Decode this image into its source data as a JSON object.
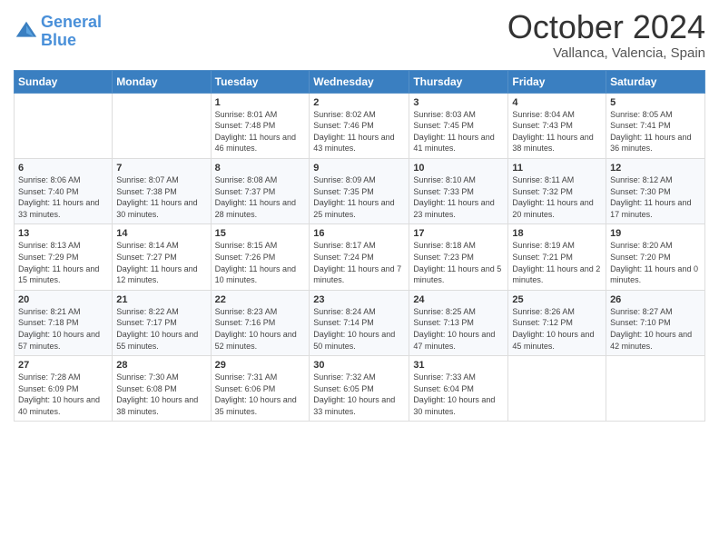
{
  "header": {
    "logo_line1": "General",
    "logo_line2": "Blue",
    "month": "October 2024",
    "location": "Vallanca, Valencia, Spain"
  },
  "days_of_week": [
    "Sunday",
    "Monday",
    "Tuesday",
    "Wednesday",
    "Thursday",
    "Friday",
    "Saturday"
  ],
  "weeks": [
    [
      {
        "day": "",
        "info": ""
      },
      {
        "day": "",
        "info": ""
      },
      {
        "day": "1",
        "info": "Sunrise: 8:01 AM\nSunset: 7:48 PM\nDaylight: 11 hours and 46 minutes."
      },
      {
        "day": "2",
        "info": "Sunrise: 8:02 AM\nSunset: 7:46 PM\nDaylight: 11 hours and 43 minutes."
      },
      {
        "day": "3",
        "info": "Sunrise: 8:03 AM\nSunset: 7:45 PM\nDaylight: 11 hours and 41 minutes."
      },
      {
        "day": "4",
        "info": "Sunrise: 8:04 AM\nSunset: 7:43 PM\nDaylight: 11 hours and 38 minutes."
      },
      {
        "day": "5",
        "info": "Sunrise: 8:05 AM\nSunset: 7:41 PM\nDaylight: 11 hours and 36 minutes."
      }
    ],
    [
      {
        "day": "6",
        "info": "Sunrise: 8:06 AM\nSunset: 7:40 PM\nDaylight: 11 hours and 33 minutes."
      },
      {
        "day": "7",
        "info": "Sunrise: 8:07 AM\nSunset: 7:38 PM\nDaylight: 11 hours and 30 minutes."
      },
      {
        "day": "8",
        "info": "Sunrise: 8:08 AM\nSunset: 7:37 PM\nDaylight: 11 hours and 28 minutes."
      },
      {
        "day": "9",
        "info": "Sunrise: 8:09 AM\nSunset: 7:35 PM\nDaylight: 11 hours and 25 minutes."
      },
      {
        "day": "10",
        "info": "Sunrise: 8:10 AM\nSunset: 7:33 PM\nDaylight: 11 hours and 23 minutes."
      },
      {
        "day": "11",
        "info": "Sunrise: 8:11 AM\nSunset: 7:32 PM\nDaylight: 11 hours and 20 minutes."
      },
      {
        "day": "12",
        "info": "Sunrise: 8:12 AM\nSunset: 7:30 PM\nDaylight: 11 hours and 17 minutes."
      }
    ],
    [
      {
        "day": "13",
        "info": "Sunrise: 8:13 AM\nSunset: 7:29 PM\nDaylight: 11 hours and 15 minutes."
      },
      {
        "day": "14",
        "info": "Sunrise: 8:14 AM\nSunset: 7:27 PM\nDaylight: 11 hours and 12 minutes."
      },
      {
        "day": "15",
        "info": "Sunrise: 8:15 AM\nSunset: 7:26 PM\nDaylight: 11 hours and 10 minutes."
      },
      {
        "day": "16",
        "info": "Sunrise: 8:17 AM\nSunset: 7:24 PM\nDaylight: 11 hours and 7 minutes."
      },
      {
        "day": "17",
        "info": "Sunrise: 8:18 AM\nSunset: 7:23 PM\nDaylight: 11 hours and 5 minutes."
      },
      {
        "day": "18",
        "info": "Sunrise: 8:19 AM\nSunset: 7:21 PM\nDaylight: 11 hours and 2 minutes."
      },
      {
        "day": "19",
        "info": "Sunrise: 8:20 AM\nSunset: 7:20 PM\nDaylight: 11 hours and 0 minutes."
      }
    ],
    [
      {
        "day": "20",
        "info": "Sunrise: 8:21 AM\nSunset: 7:18 PM\nDaylight: 10 hours and 57 minutes."
      },
      {
        "day": "21",
        "info": "Sunrise: 8:22 AM\nSunset: 7:17 PM\nDaylight: 10 hours and 55 minutes."
      },
      {
        "day": "22",
        "info": "Sunrise: 8:23 AM\nSunset: 7:16 PM\nDaylight: 10 hours and 52 minutes."
      },
      {
        "day": "23",
        "info": "Sunrise: 8:24 AM\nSunset: 7:14 PM\nDaylight: 10 hours and 50 minutes."
      },
      {
        "day": "24",
        "info": "Sunrise: 8:25 AM\nSunset: 7:13 PM\nDaylight: 10 hours and 47 minutes."
      },
      {
        "day": "25",
        "info": "Sunrise: 8:26 AM\nSunset: 7:12 PM\nDaylight: 10 hours and 45 minutes."
      },
      {
        "day": "26",
        "info": "Sunrise: 8:27 AM\nSunset: 7:10 PM\nDaylight: 10 hours and 42 minutes."
      }
    ],
    [
      {
        "day": "27",
        "info": "Sunrise: 7:28 AM\nSunset: 6:09 PM\nDaylight: 10 hours and 40 minutes."
      },
      {
        "day": "28",
        "info": "Sunrise: 7:30 AM\nSunset: 6:08 PM\nDaylight: 10 hours and 38 minutes."
      },
      {
        "day": "29",
        "info": "Sunrise: 7:31 AM\nSunset: 6:06 PM\nDaylight: 10 hours and 35 minutes."
      },
      {
        "day": "30",
        "info": "Sunrise: 7:32 AM\nSunset: 6:05 PM\nDaylight: 10 hours and 33 minutes."
      },
      {
        "day": "31",
        "info": "Sunrise: 7:33 AM\nSunset: 6:04 PM\nDaylight: 10 hours and 30 minutes."
      },
      {
        "day": "",
        "info": ""
      },
      {
        "day": "",
        "info": ""
      }
    ]
  ]
}
